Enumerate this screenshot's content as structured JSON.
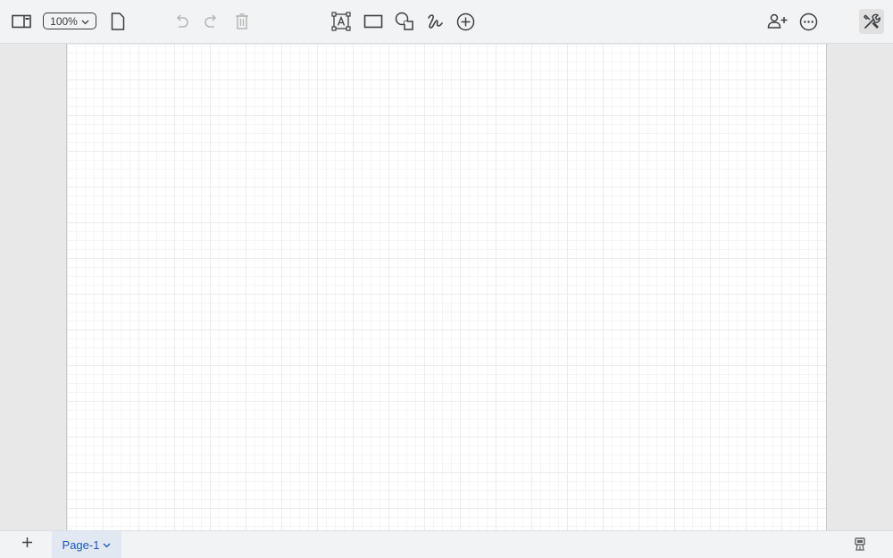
{
  "toolbar": {
    "zoom_value": "100%",
    "buttons": [
      {
        "id": "format-panel",
        "icon": "sidebar-panel-icon"
      },
      {
        "id": "page-setup",
        "icon": "page-icon"
      },
      {
        "id": "undo",
        "icon": "undo-icon"
      },
      {
        "id": "redo",
        "icon": "redo-icon"
      },
      {
        "id": "delete",
        "icon": "trash-icon"
      },
      {
        "id": "text",
        "icon": "text-box-icon"
      },
      {
        "id": "rectangle",
        "icon": "rectangle-icon"
      },
      {
        "id": "shapes",
        "icon": "shapes-icon"
      },
      {
        "id": "freehand",
        "icon": "freehand-icon"
      },
      {
        "id": "insert",
        "icon": "plus-circle-icon"
      },
      {
        "id": "share",
        "icon": "add-user-icon"
      },
      {
        "id": "more",
        "icon": "more-icon"
      },
      {
        "id": "tools",
        "icon": "tools-icon"
      }
    ]
  },
  "pages": {
    "add_label": "+",
    "tabs": [
      {
        "label": "Page-1",
        "active": true
      }
    ]
  },
  "colors": {
    "toolbar_bg": "#f1f3f4",
    "icon": "#3c4043",
    "icon_disabled": "#b6b6b6",
    "page_tab_bg": "#e2e8f2",
    "page_tab_text": "#1a57b6",
    "grid_major": "#ececec",
    "grid_minor": "#f5f5f5"
  }
}
